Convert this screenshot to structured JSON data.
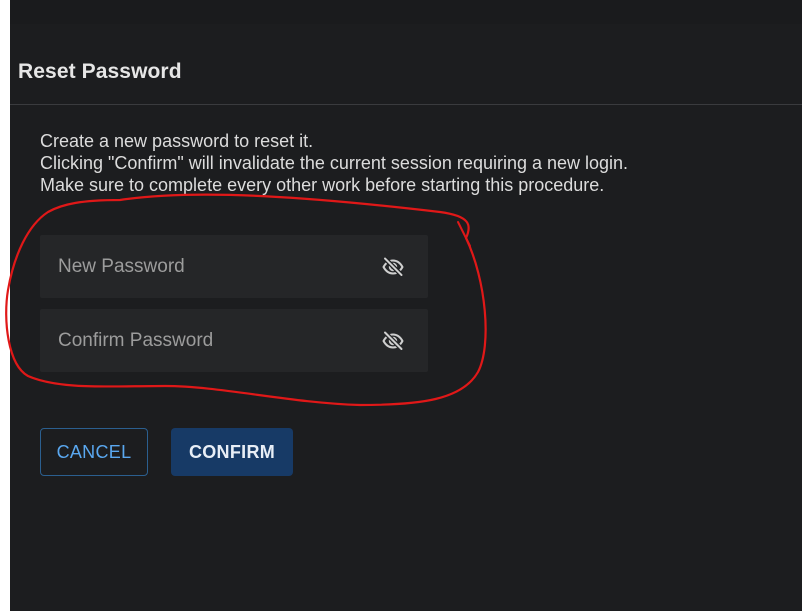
{
  "dialog": {
    "title": "Reset Password",
    "description": [
      "Create a new password to reset it.",
      "Clicking \"Confirm\" will invalidate the current session requiring a new login.",
      "Make sure to complete every other work before starting this procedure."
    ]
  },
  "fields": {
    "new_password": {
      "placeholder": "New Password",
      "value": "",
      "icon": "eye-off-icon"
    },
    "confirm_password": {
      "placeholder": "Confirm Password",
      "value": "",
      "icon": "eye-off-icon"
    }
  },
  "buttons": {
    "cancel_label": "CANCEL",
    "confirm_label": "CONFIRM"
  },
  "colors": {
    "background": "#1c1d1f",
    "field_background": "#252628",
    "cancel_text": "#5aa8f0",
    "confirm_background": "#173a66",
    "annotation_stroke": "#e01818"
  }
}
